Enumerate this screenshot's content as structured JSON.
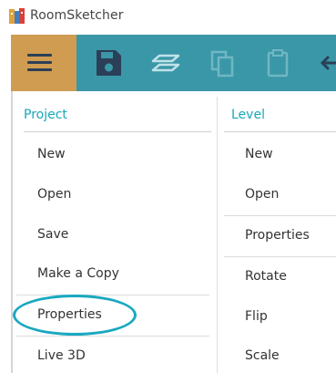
{
  "window": {
    "app_title": "RoomSketcher"
  },
  "toolbar": {
    "menu_icon": "hamburger-menu-icon",
    "tools": [
      {
        "icon": "save-icon"
      },
      {
        "icon": "layers-icon"
      },
      {
        "icon": "copy-icon"
      },
      {
        "icon": "paste-icon"
      },
      {
        "icon": "undo-icon"
      }
    ]
  },
  "menu": {
    "project": {
      "header": "Project",
      "items": [
        "New",
        "Open",
        "Save",
        "Make a Copy",
        "Properties",
        "Live 3D"
      ]
    },
    "level": {
      "header": "Level",
      "items": [
        "New",
        "Open",
        "Properties",
        "Rotate",
        "Flip",
        "Scale"
      ]
    },
    "highlighted_item": "Properties"
  },
  "colors": {
    "toolbar": "#3a97a8",
    "menu_button": "#cf9c52",
    "accent": "#19a7bb",
    "highlight": "#1aa8c0"
  }
}
